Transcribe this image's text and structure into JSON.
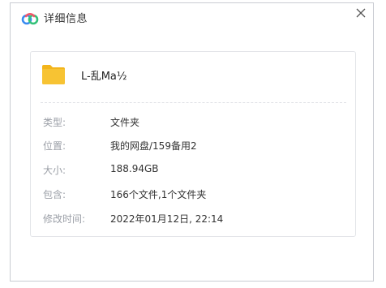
{
  "dialog": {
    "title": "详细信息",
    "logo_icon": "baidu-netdisk-cloud-icon",
    "close_icon": "close-icon"
  },
  "file": {
    "icon": "folder-icon",
    "name": "L-乱Ma½"
  },
  "details": [
    {
      "label": "类型:",
      "value": "文件夹"
    },
    {
      "label": "位置:",
      "value": "我的网盘/159备用2"
    },
    {
      "label": "大小:",
      "value": "188.94GB"
    },
    {
      "label": "包含:",
      "value": "166个文件,1个文件夹"
    },
    {
      "label": "修改时间:",
      "value": "2022年01月12日, 22:14"
    }
  ],
  "colors": {
    "logo_blue": "#3a8cf0",
    "logo_green": "#34c27a",
    "logo_red": "#f2566a",
    "folder": "#f7c333",
    "folder_tab": "#f3b51b"
  }
}
